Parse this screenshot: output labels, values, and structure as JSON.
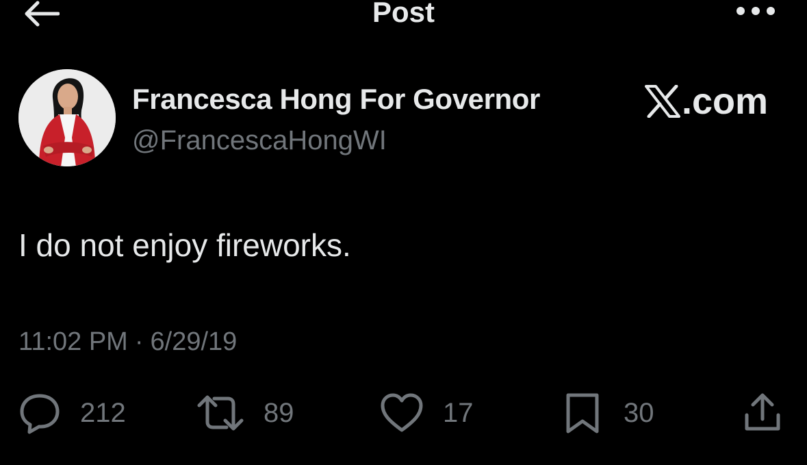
{
  "header": {
    "title": "Post",
    "back_icon": "arrow-left-icon",
    "more_icon": "more-horizontal-icon"
  },
  "author": {
    "display_name": "Francesca Hong For Governor",
    "handle": "@FrancescaHongWI"
  },
  "watermark": {
    "text": ".com",
    "logo": "x-logo-icon"
  },
  "tweet": {
    "text": "I do not enjoy fireworks.",
    "time": "11:02 PM",
    "separator": "·",
    "date": "6/29/19"
  },
  "actions": {
    "replies": "212",
    "reposts": "89",
    "likes": "17",
    "bookmarks": "30"
  },
  "colors": {
    "background": "#000000",
    "primary_text": "#e7e9ea",
    "secondary_text": "#71767b",
    "jacket_red": "#c8202a"
  }
}
